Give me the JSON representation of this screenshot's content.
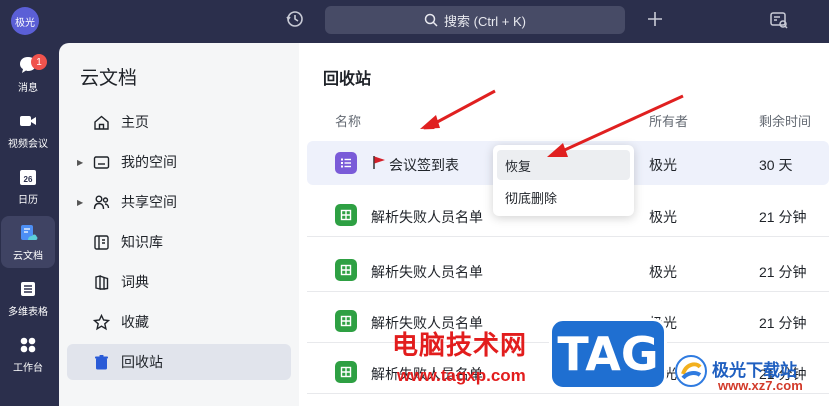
{
  "topbar": {
    "avatar": "极光",
    "search_label": "搜索 (Ctrl + K)"
  },
  "rail": {
    "items": [
      {
        "label": "消息",
        "badge": "1",
        "icon": "chat-icon"
      },
      {
        "label": "视频会议",
        "icon": "video-icon"
      },
      {
        "label": "日历",
        "icon": "calendar-icon",
        "day": "26"
      },
      {
        "label": "云文档",
        "icon": "cloud-doc-icon",
        "active": true
      },
      {
        "label": "多维表格",
        "icon": "table-icon"
      },
      {
        "label": "工作台",
        "icon": "apps-icon"
      }
    ]
  },
  "sidebar": {
    "title": "云文档",
    "items": [
      {
        "label": "主页",
        "icon": "home-icon"
      },
      {
        "label": "我的空间",
        "icon": "folder-icon",
        "expandable": true
      },
      {
        "label": "共享空间",
        "icon": "people-icon",
        "expandable": true
      },
      {
        "label": "知识库",
        "icon": "wiki-icon"
      },
      {
        "label": "词典",
        "icon": "dictionary-icon"
      },
      {
        "label": "收藏",
        "icon": "star-icon"
      },
      {
        "label": "回收站",
        "icon": "trash-icon",
        "active": true
      }
    ]
  },
  "main": {
    "title": "回收站",
    "columns": {
      "name": "名称",
      "owner": "所有者",
      "remain": "剩余时间"
    },
    "rows": [
      {
        "name": "会议签到表",
        "owner": "极光",
        "remain": "30 天",
        "icon": "doc-list-icon",
        "flagged": true
      },
      {
        "name": "解析失败人员名单",
        "owner": "极光",
        "remain": "21 分钟",
        "icon": "sheet-icon"
      },
      {
        "name": "解析失败人员名单",
        "owner": "极光",
        "remain": "21 分钟",
        "icon": "sheet-icon"
      },
      {
        "name": "解析失败人员名单",
        "owner": "极光",
        "remain": "21 分钟",
        "icon": "sheet-icon"
      },
      {
        "name": "解析失败人员名单",
        "owner": "极光",
        "remain": "21 分钟",
        "icon": "sheet-icon"
      }
    ]
  },
  "context_menu": {
    "restore": "恢复",
    "delete_forever": "彻底删除"
  },
  "watermarks": {
    "site_cn": "电脑技术网",
    "site_url": "www.tagxp.com",
    "tag": "TAG",
    "jg_title": "极光下载站",
    "jg_url": "www.xz7.com"
  },
  "colors": {
    "topbar_bg": "#2b2f4c",
    "accent_purple": "#7a5bd8",
    "sheet_green": "#2ea043",
    "arrow_red": "#e02020",
    "row_highlight": "#eef1fb"
  }
}
